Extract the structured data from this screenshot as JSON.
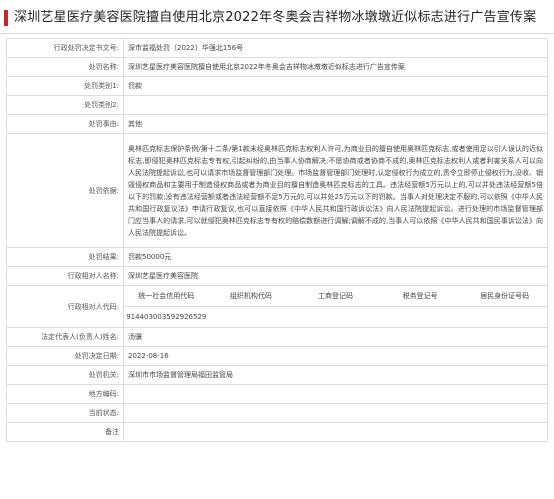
{
  "header": {
    "title": "深圳艺星医疗美容医院擅自使用北京2022年冬奥会吉祥物冰墩墩近似标志进行广告宣传案"
  },
  "rows": [
    {
      "label": "行政处罚决定书文号:",
      "value": "深市监福处罚〔2022〕华强北156号"
    },
    {
      "label": "处罚名称:",
      "value": "深圳艺星医疗美容医院擅自使用北京2022年冬奥会吉祥物冰墩墩近似标志进行广告宣传案"
    },
    {
      "label": "处罚类别1:",
      "value": "罚款"
    },
    {
      "label": "处罚类别2:",
      "value": ""
    },
    {
      "label": "处罚事由:",
      "value": "其他"
    },
    {
      "label": "处罚依据:",
      "value": "奥林匹克标志保护条例/第十二条/第1款未经奥林匹克标志权利人许可,为商业目的擅自使用奥林匹克标志,或者使用足以引人误认的近似标志,即侵犯奥林匹克标志专有权,引起纠纷的,由当事人协商解决;不愿协商或者协商不成的,奥林匹克标志权利人或者利害关系人可以向人民法院提起诉讼,也可以请求市场监督管理部门处理。市场监督管理部门处理时,认定侵权行为成立的,责令立即停止侵权行为,没收、销毁侵权商品和主要用于制造侵权商品或者为商业目的擅自制造奥林匹克标志的工具。违法经营额5万元以上的,可以并处违法经营额5倍以下的罚款;没有违法经营额或者违法经营额不足5万元的,可以并处25万元以下的罚款。当事人对处理决定不服的,可以依照《中华人民共和国行政复议法》申请行政复议,也可以直接依照《中华人民共和国行政诉讼法》向人民法院提起诉讼。进行处理的市场监督管理部门应当事人的请求,可以就侵犯奥林匹克标志专有权的赔偿数额进行调解;调解不成的,当事人可以依照《中华人民共和国民事诉讼法》向人民法院提起诉讼。"
    },
    {
      "label": "处罚结果:",
      "value": "罚款50000元"
    },
    {
      "label": "行政相对人名称:",
      "value": "深圳艺星医疗美容医院"
    },
    {
      "label": "行政相对人代码:",
      "value": ""
    },
    {
      "label": "法定代表人(负责人)姓名:",
      "value": "汤骥"
    },
    {
      "label": "处罚决定日期:",
      "value": "2022-08-16"
    },
    {
      "label": "处罚机关:",
      "value": "深圳市市场监督管理局福田监管局"
    },
    {
      "label": "地方编码:",
      "value": ""
    },
    {
      "label": "当前状态:",
      "value": ""
    },
    {
      "label": "备注",
      "value": ""
    }
  ],
  "codes": {
    "headers": [
      "统一社会信用代码",
      "组织机构代码",
      "工商登记码",
      "税务登记号",
      "居民身份证号码"
    ],
    "values": [
      "914403003592926529",
      "",
      "",
      "",
      ""
    ]
  }
}
